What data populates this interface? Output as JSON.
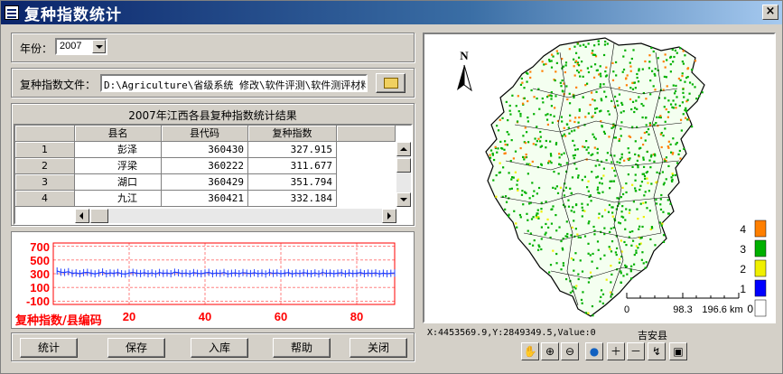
{
  "window": {
    "title": "复种指数统计",
    "close_glyph": "×"
  },
  "year": {
    "label": "年份：",
    "value": "2007"
  },
  "file": {
    "label": "复种指数文件：",
    "value": "D:\\Agriculture\\省级系统_修改\\软件评测\\软件测评材料"
  },
  "table": {
    "title": "2007年江西各县复种指数统计结果",
    "columns": [
      "县名",
      "县代码",
      "复种指数"
    ],
    "rows": [
      {
        "idx": "1",
        "name": "彭泽",
        "code": "360430",
        "value": "327.915"
      },
      {
        "idx": "2",
        "name": "浮梁",
        "code": "360222",
        "value": "311.677"
      },
      {
        "idx": "3",
        "name": "湖口",
        "code": "360429",
        "value": "351.794"
      },
      {
        "idx": "4",
        "name": "九江",
        "code": "360421",
        "value": "332.184"
      }
    ]
  },
  "chart_data": {
    "type": "line",
    "title": "",
    "xlabel": "复种指数/县编码",
    "ylabel": "",
    "yticks": [
      "700",
      "500",
      "300",
      "100",
      "-100"
    ],
    "xticks": [
      "20",
      "40",
      "60",
      "80"
    ],
    "xlim": [
      0,
      90
    ],
    "ylim": [
      -150,
      750
    ],
    "grid": true,
    "series_color": "#2040ff",
    "axis_color": "#ff0000",
    "series": [
      {
        "values": [
          340,
          322,
          318,
          330,
          305,
          312,
          300,
          315,
          320,
          308,
          298,
          310,
          325,
          300,
          312,
          305,
          318,
          300,
          295,
          310,
          320,
          308,
          302,
          315,
          300,
          312,
          296,
          318,
          305,
          310,
          300,
          322,
          314,
          302,
          310,
          298,
          316,
          306,
          300,
          312,
          320,
          300,
          310,
          304,
          318,
          298,
          306,
          312,
          300,
          316,
          308,
          302,
          314,
          300,
          310,
          296,
          318,
          304,
          312,
          300,
          308,
          316,
          298,
          310,
          302,
          314,
          306,
          300,
          312,
          296,
          318,
          304,
          310,
          300,
          308,
          314,
          298,
          312,
          302,
          306,
          316,
          300,
          310,
          304,
          312,
          298,
          308,
          300,
          306,
          310
        ]
      }
    ]
  },
  "buttons": {
    "stat": "统计",
    "save": "保存",
    "import": "入库",
    "help": "帮助",
    "close": "关闭"
  },
  "map": {
    "north": "N",
    "legend_values": [
      "4",
      "3",
      "2",
      "1",
      "0"
    ],
    "legend_colors": [
      "#ff7f00",
      "#00b000",
      "#f0f000",
      "#0000ff",
      "#ffffff"
    ],
    "scale_labels": [
      "0",
      "98.3",
      "196.6 km"
    ],
    "status_coords": "X:4453569.9,Y:2849349.5,Value:0",
    "status_county": "吉安县",
    "tools": [
      "pan-icon",
      "zoom-in-icon",
      "zoom-out-icon",
      "globe-icon",
      "plus-icon",
      "minus-icon",
      "identify-icon",
      "save-icon"
    ]
  }
}
